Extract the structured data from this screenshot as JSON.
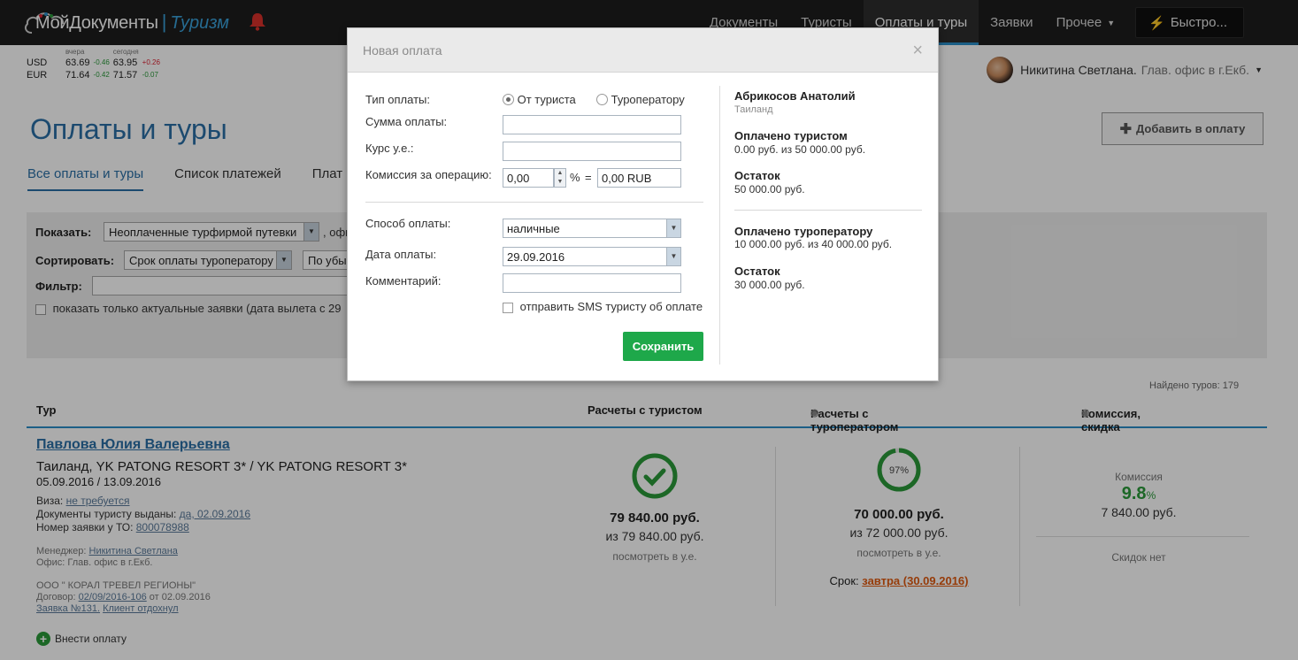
{
  "header": {
    "logo_main": "МойДокументы",
    "logo_sub": "Туризм",
    "nav": [
      "Документы",
      "Туристы",
      "Оплаты и туры",
      "Заявки",
      "Прочее"
    ],
    "quick_button": "Быстро...",
    "icons": {
      "bell": "bell-icon",
      "bolt": "bolt-icon"
    }
  },
  "rates": {
    "yesterday_label": "вчера",
    "today_label": "сегодня",
    "rows": [
      {
        "code": "USD",
        "y_val": "63.69",
        "y_diff": "-0.46",
        "t_val": "63.95",
        "t_diff": "+0.26"
      },
      {
        "code": "EUR",
        "y_val": "71.64",
        "y_diff": "-0.42",
        "t_val": "71.57",
        "t_diff": "-0.07"
      }
    ]
  },
  "user": {
    "name": "Никитина Светлана.",
    "office": "Глав. офис в г.Екб."
  },
  "page": {
    "title": "Оплаты и туры",
    "add_button": "Добавить в оплату",
    "tabs": [
      "Все оплаты и туры",
      "Список платежей",
      "Плат"
    ]
  },
  "filter": {
    "show_label": "Показать:",
    "show_value": "Неоплаченные турфирмой путевки",
    "show_after": ", офи",
    "sort_label": "Сортировать:",
    "sort_value": "Срок оплаты туроператору",
    "sort_dir": "По убы",
    "filter_label": "Фильтр:",
    "actual_only": "показать только актуальные заявки (дата вылета с 29"
  },
  "list": {
    "found": "Найдено туров: 179",
    "col_tour": "Тур",
    "col_tourist": "Расчеты с туристом",
    "col_operator": "Расчеты с туроператором",
    "col_commission": "Комиссия, скидка",
    "tour": {
      "name": "Павлова Юлия Валерьевна",
      "hotel": "Таиланд, YK PATONG RESORT 3* / YK PATONG RESORT 3*",
      "dates": "05.09.2016 / 13.09.2016",
      "visa_label": "Виза:",
      "visa_value": "не требуется",
      "docs_label": "Документы туристу выданы:",
      "docs_value": "да, 02.09.2016",
      "order_label": "Номер заявки у ТО:",
      "order_value": "800078988",
      "manager_label": "Менеджер:",
      "manager_value": "Никитина Светлана",
      "office": "Офис: Глав. офис в г.Екб.",
      "company": "ООО \" КОРАЛ ТРЕВЕЛ РЕГИОНЫ\"",
      "contract_label": "Договор:",
      "contract_value": "02/09/2016-106",
      "contract_date": "от 02.09.2016",
      "request_value": "Заявка №131.",
      "review_value": "Клиент отдохнул",
      "pay_link": "Внести оплату"
    },
    "tourist": {
      "paid": "79 840.00 руб.",
      "of": "из 79 840.00 руб.",
      "ue": "посмотреть в у.е.",
      "progress": 1.0
    },
    "operator": {
      "percent": "97%",
      "progress": 0.97,
      "paid": "70 000.00 руб.",
      "of": "из 72 000.00 руб.",
      "ue": "посмотреть в у.е.",
      "deadline_label": "Срок:",
      "deadline_value": "завтра (30.09.2016)"
    },
    "commission": {
      "label": "Комиссия",
      "percent": "9.8",
      "percent_sign": "%",
      "amount": "7 840.00 руб.",
      "discount": "Скидок нет"
    }
  },
  "modal": {
    "title": "Новая оплата",
    "close": "×",
    "type_label": "Тип оплаты:",
    "type_options": [
      "От туриста",
      "Туроператору"
    ],
    "type_selected": "От туриста",
    "sum_label": "Сумма оплаты:",
    "sum_value": "",
    "rate_label": "Курс у.е.:",
    "rate_value": "",
    "commission_label": "Комиссия за операцию:",
    "commission_value": "0,00",
    "percent_sign": "%",
    "equals_sign": "=",
    "commission_rub": "0,00 RUB",
    "method_label": "Способ оплаты:",
    "method_value": "наличные",
    "date_label": "Дата оплаты:",
    "date_value": "29.09.2016",
    "comment_label": "Комментарий:",
    "comment_value": "",
    "sms_label": "отправить SMS туристу об оплате",
    "save_button": "Сохранить",
    "side": {
      "tourist_name": "Абрикосов Анатолий",
      "country": "Таиланд",
      "paid_tourist_label": "Оплачено туристом",
      "paid_tourist_value": "0.00 руб. из 50 000.00 руб.",
      "rest1_label": "Остаток",
      "rest1_value": "50 000.00 руб.",
      "paid_op_label": "Оплачено туроператору",
      "paid_op_value": "10 000.00 руб. из 40 000.00 руб.",
      "rest2_label": "Остаток",
      "rest2_value": "30 000.00 руб."
    }
  },
  "colors": {
    "accent": "#2a6fa6",
    "nav_bg": "#1d1d1d",
    "success": "#1ea84a",
    "progress": "#2a9a3a",
    "deadline": "#e05a10"
  }
}
